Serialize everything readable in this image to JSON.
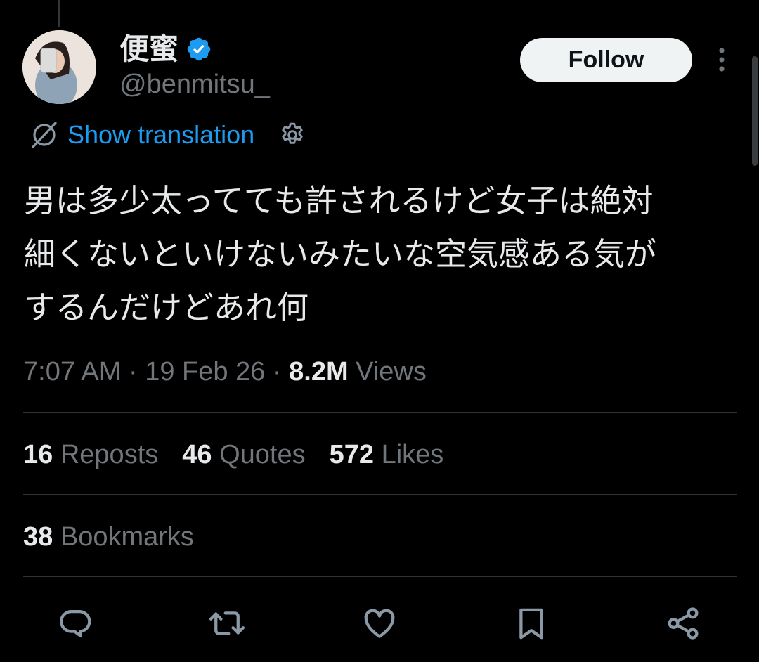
{
  "user": {
    "display_name": "便蜜",
    "handle": "@benmitsu_",
    "verified": true
  },
  "follow_label": "Follow",
  "translation": {
    "link_text": "Show translation"
  },
  "tweet": {
    "text": "男は多少太ってても許されるけど女子は絶対\n細くないといけないみたいな空気感ある気が\nするんだけどあれ何"
  },
  "meta": {
    "time": "7:07 AM",
    "sep1": "·",
    "date": "19 Feb 26",
    "sep2": "·",
    "views_count": "8.2M",
    "views_label": "Views"
  },
  "stats": [
    {
      "count": "16",
      "label": "Reposts"
    },
    {
      "count": "46",
      "label": "Quotes"
    },
    {
      "count": "572",
      "label": "Likes"
    }
  ],
  "bookmarks": {
    "count": "38",
    "label": "Bookmarks"
  },
  "actions": [
    "reply-icon",
    "repost-icon",
    "like-icon",
    "bookmark-icon",
    "share-icon"
  ],
  "colors": {
    "background": "#000000",
    "text": "#e7e9ea",
    "secondary": "#71767b",
    "accent": "#1d9bf0",
    "divider": "#2f3336"
  }
}
